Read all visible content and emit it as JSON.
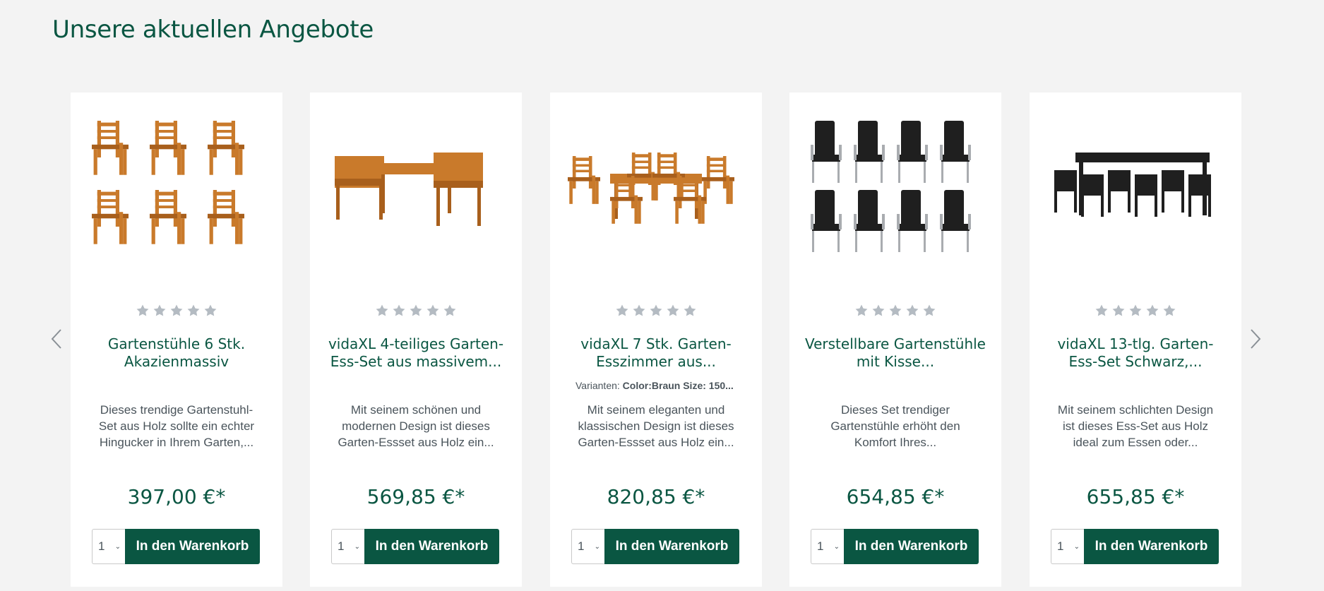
{
  "section": {
    "title": "Unsere aktuellen Angebote"
  },
  "colors": {
    "brand": "#0a5642",
    "star": "#b4bbc2",
    "text": "#4a545b"
  },
  "slider": {
    "prev_icon": "chevron-left-icon",
    "next_icon": "chevron-right-icon"
  },
  "products": [
    {
      "title": "Gartenstühle 6 Stk. Akazienmassiv",
      "variants_label": "",
      "variants_value": "",
      "description": "Dieses trendige Gartenstuhl-Set aus Holz sollte ein echter Hingucker in Ihrem Garten,...",
      "price": "397,00 €*",
      "qty": "1",
      "buy_label": "In den Warenkorb",
      "image_icon": "wooden-chairs-image"
    },
    {
      "title": "vidaXL 4-teiliges Garten-Ess-Set aus massivem...",
      "variants_label": "",
      "variants_value": "",
      "description": "Mit seinem schönen und modernen Design ist dieses Garten-Essset aus Holz ein...",
      "price": "569,85 €*",
      "qty": "1",
      "buy_label": "In den Warenkorb",
      "image_icon": "garden-dining-set-image"
    },
    {
      "title": "vidaXL 7 Stk. Garten-Esszimmer aus...",
      "variants_label": "Varianten:",
      "variants_value": "Color:Braun Size: 150...",
      "description": "Mit seinem eleganten und klassischen Design ist dieses Garten-Essset aus Holz ein...",
      "price": "820,85 €*",
      "qty": "1",
      "buy_label": "In den Warenkorb",
      "image_icon": "teak-dining-set-image"
    },
    {
      "title": "Verstellbare Gartenstühle mit Kisse...",
      "variants_label": "",
      "variants_value": "",
      "description": "Dieses Set trendiger Gartenstühle erhöht den Komfort Ihres...",
      "price": "654,85 €*",
      "qty": "1",
      "buy_label": "In den Warenkorb",
      "image_icon": "cushioned-chairs-image"
    },
    {
      "title": "vidaXL 13-tlg. Garten-Ess-Set Schwarz,...",
      "variants_label": "",
      "variants_value": "",
      "description": "Mit seinem schlichten Design ist dieses Ess-Set aus Holz ideal zum Essen oder...",
      "price": "655,85 €*",
      "qty": "1",
      "buy_label": "In den Warenkorb",
      "image_icon": "black-dining-set-image"
    }
  ]
}
